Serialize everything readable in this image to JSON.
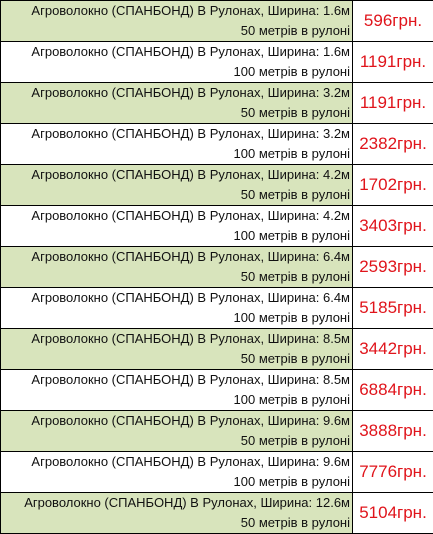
{
  "table": {
    "rows": [
      {
        "line1": "Агроволокно (СПАНБОНД) В Рулонах, Ширина: 1.6м",
        "line2": "50 метрів в рулоні",
        "price": "596грн.",
        "shade": "green"
      },
      {
        "line1": "Агроволокно (СПАНБОНД) В Рулонах, Ширина: 1.6м",
        "line2": "100 метрів в рулоні",
        "price": "1191грн.",
        "shade": "white"
      },
      {
        "line1": "Агроволокно (СПАНБОНД) В Рулонах, Ширина: 3.2м",
        "line2": "50 метрів в рулоні",
        "price": "1191грн.",
        "shade": "green"
      },
      {
        "line1": "Агроволокно (СПАНБОНД) В Рулонах, Ширина: 3.2м",
        "line2": "100 метрів в рулоні",
        "price": "2382грн.",
        "shade": "white"
      },
      {
        "line1": "Агроволокно (СПАНБОНД) В Рулонах, Ширина: 4.2м",
        "line2": "50 метрів в рулоні",
        "price": "1702грн.",
        "shade": "green"
      },
      {
        "line1": "Агроволокно (СПАНБОНД) В Рулонах, Ширина: 4.2м",
        "line2": "100 метрів в рулоні",
        "price": "3403грн.",
        "shade": "white"
      },
      {
        "line1": "Агроволокно (СПАНБОНД) В Рулонах, Ширина: 6.4м",
        "line2": "50 метрів в рулоні",
        "price": "2593грн.",
        "shade": "green"
      },
      {
        "line1": "Агроволокно (СПАНБОНД) В Рулонах, Ширина: 6.4м",
        "line2": "100 метрів в рулоні",
        "price": "5185грн.",
        "shade": "white"
      },
      {
        "line1": "Агроволокно (СПАНБОНД) В Рулонах, Ширина: 8.5м",
        "line2": "50 метрів в рулоні",
        "price": "3442грн.",
        "shade": "green"
      },
      {
        "line1": "Агроволокно (СПАНБОНД) В Рулонах, Ширина: 8.5м",
        "line2": "100 метрів в рулоні",
        "price": "6884грн.",
        "shade": "white"
      },
      {
        "line1": "Агроволокно (СПАНБОНД) В Рулонах, Ширина: 9.6м",
        "line2": "50 метрів в рулоні",
        "price": "3888грн.",
        "shade": "green"
      },
      {
        "line1": "Агроволокно (СПАНБОНД) В Рулонах, Ширина: 9.6м",
        "line2": "100 метрів в рулоні",
        "price": "7776грн.",
        "shade": "white"
      },
      {
        "line1": "Агроволокно (СПАНБОНД) В Рулонах, Ширина: 12.6м",
        "line2": "50 метрів в рулоні",
        "price": "5104грн.",
        "shade": "green"
      }
    ]
  },
  "colors": {
    "green_row": "#d8e4bc",
    "price_text": "#e0141b",
    "border": "#000000"
  }
}
